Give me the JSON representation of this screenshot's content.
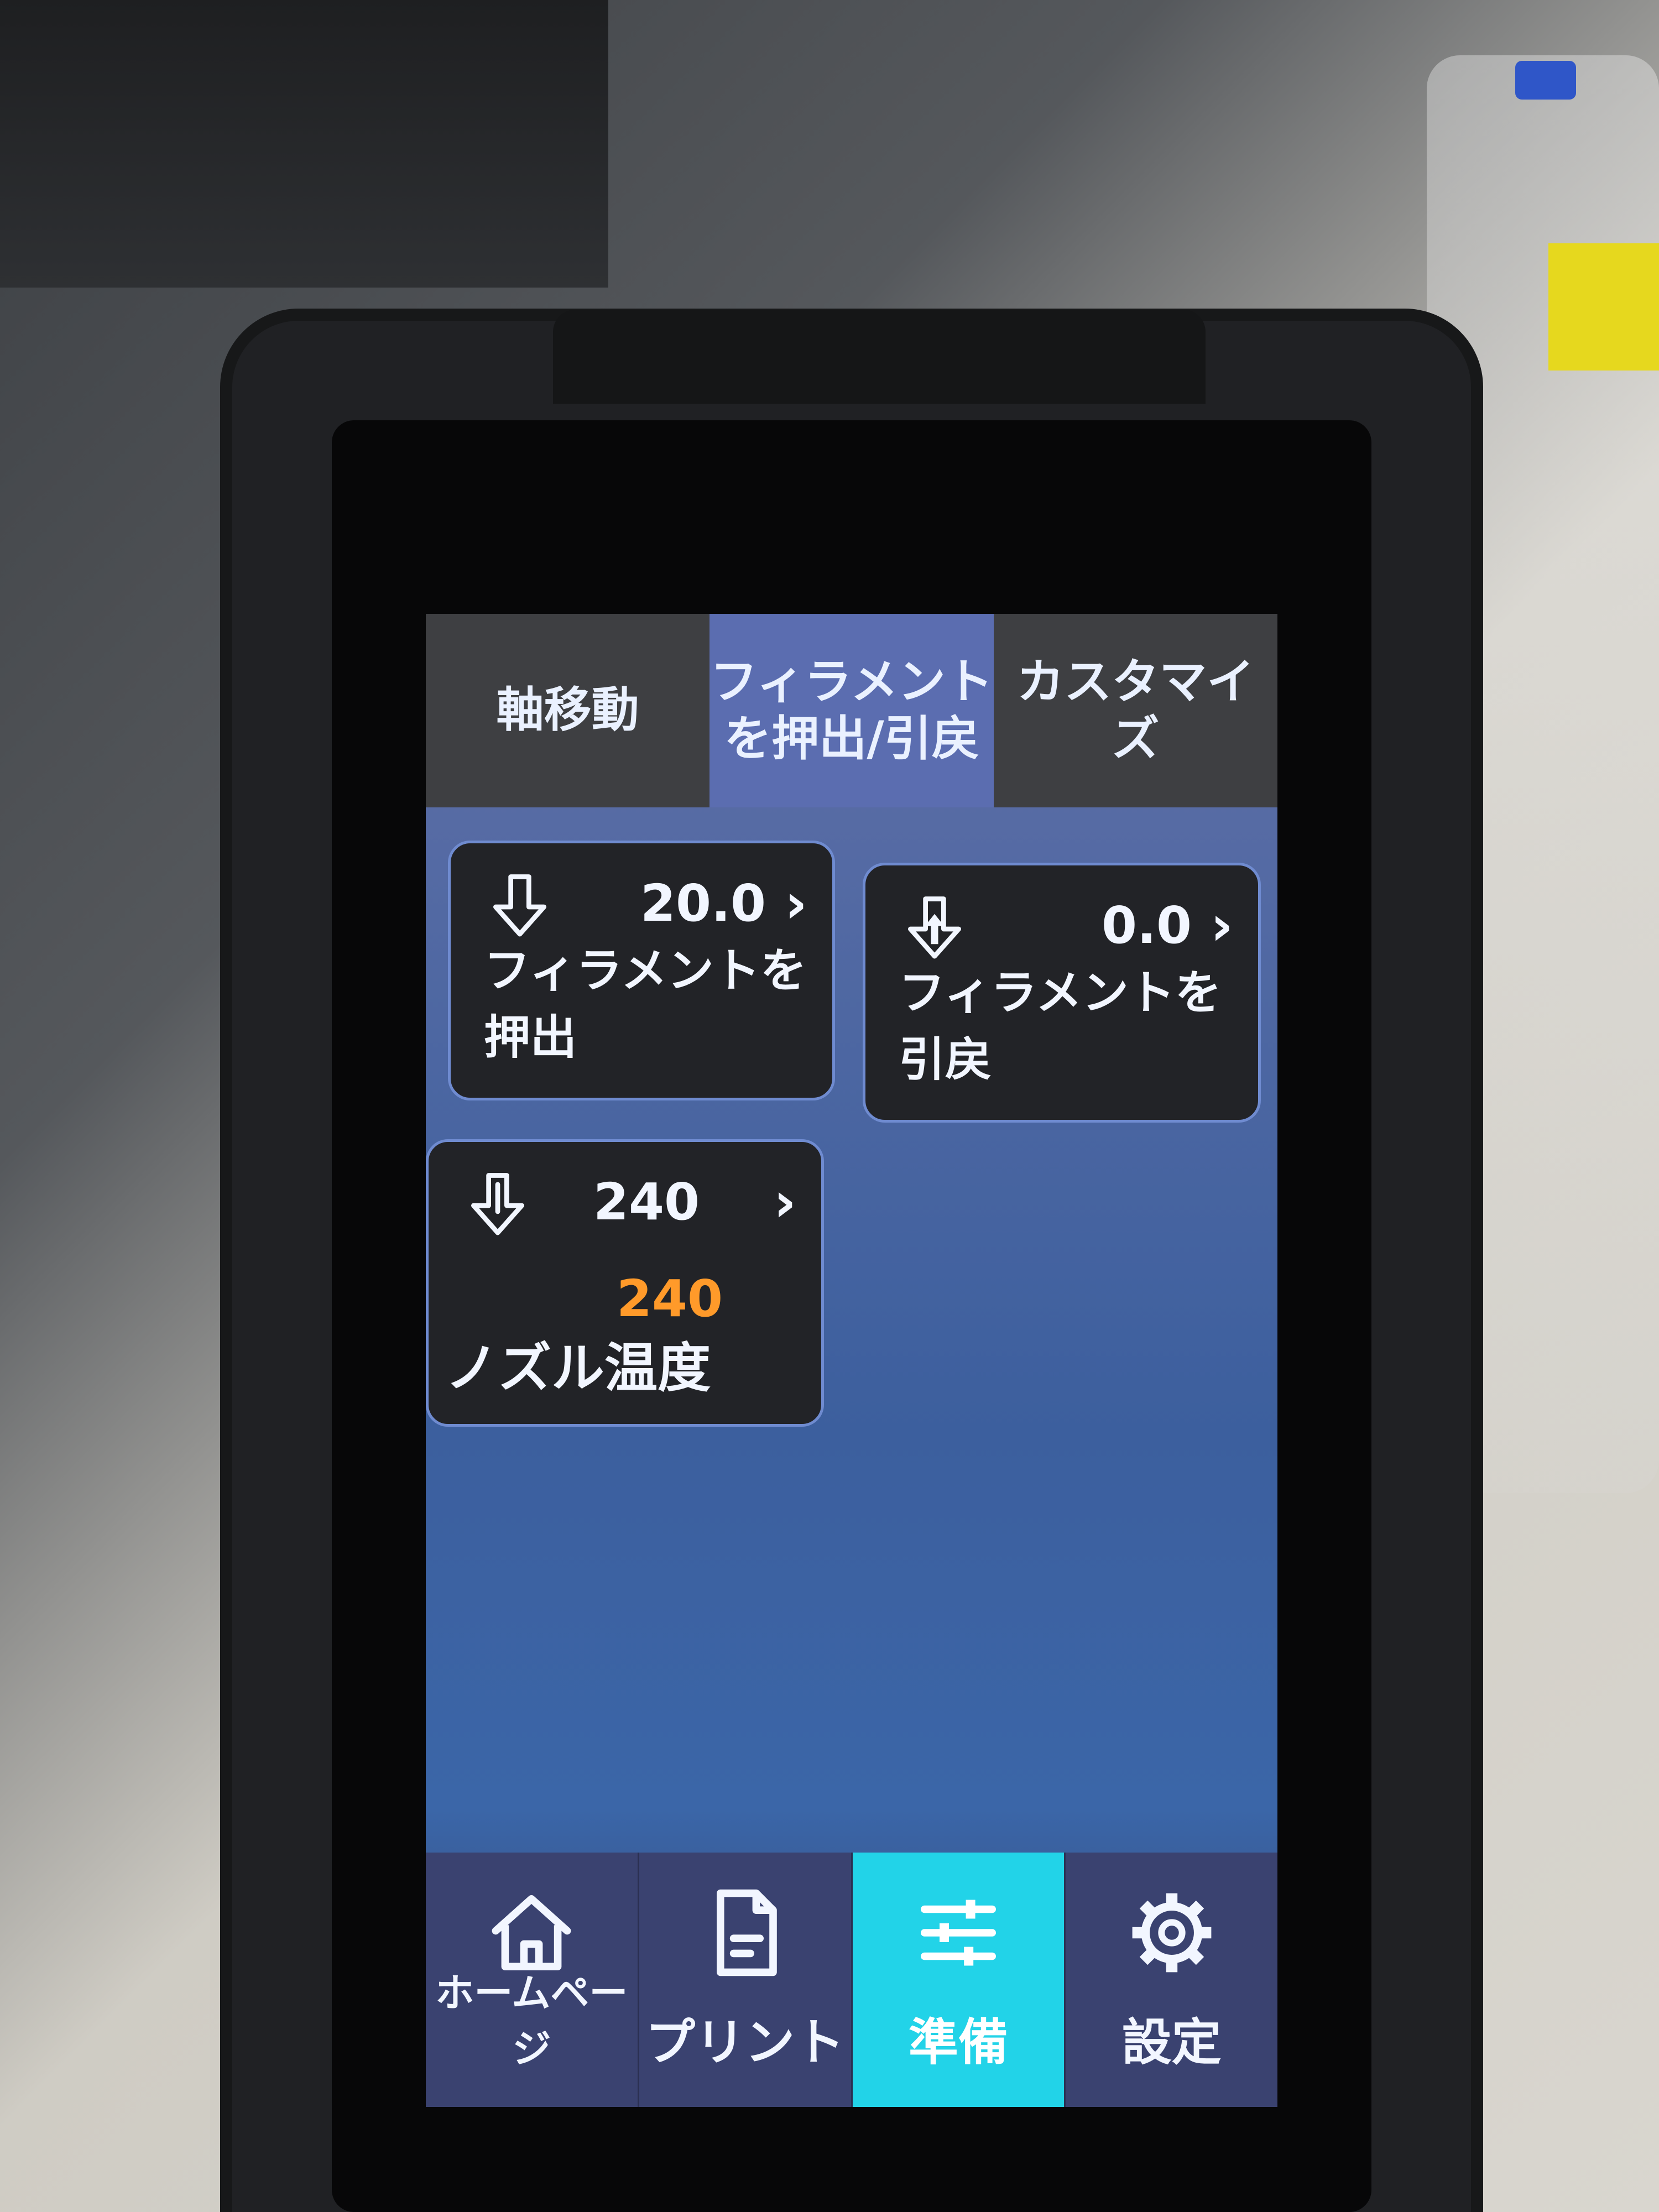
{
  "tabs": [
    {
      "label": "軸移動"
    },
    {
      "label": "フィラメント\nを押出/引戻"
    },
    {
      "label": "カスタマイズ"
    }
  ],
  "active_tab": 1,
  "cards": {
    "extrude": {
      "value": "20.0",
      "chevron": "›",
      "label": "フィラメントを押出",
      "icon": "arrow-down-icon"
    },
    "retract": {
      "value": "0.0",
      "chevron": "›",
      "label": "フィラメントを引戻",
      "icon": "arrow-up-icon"
    },
    "nozzle_temp": {
      "target": "240",
      "current": "240",
      "chevron": "›",
      "label": "ノズル温度",
      "icon": "thermometer-icon",
      "current_color": "#ff9a2a"
    }
  },
  "nav": [
    {
      "label": "ホームページ",
      "icon": "home-icon"
    },
    {
      "label": "プリント",
      "icon": "file-icon"
    },
    {
      "label": "準備",
      "icon": "sliders-icon"
    },
    {
      "label": "設定",
      "icon": "gear-icon"
    }
  ],
  "active_nav": 2,
  "colors": {
    "accent": "#22d3e8",
    "tab_active": "#5b6db0",
    "card_border": "#6f8bd0"
  }
}
